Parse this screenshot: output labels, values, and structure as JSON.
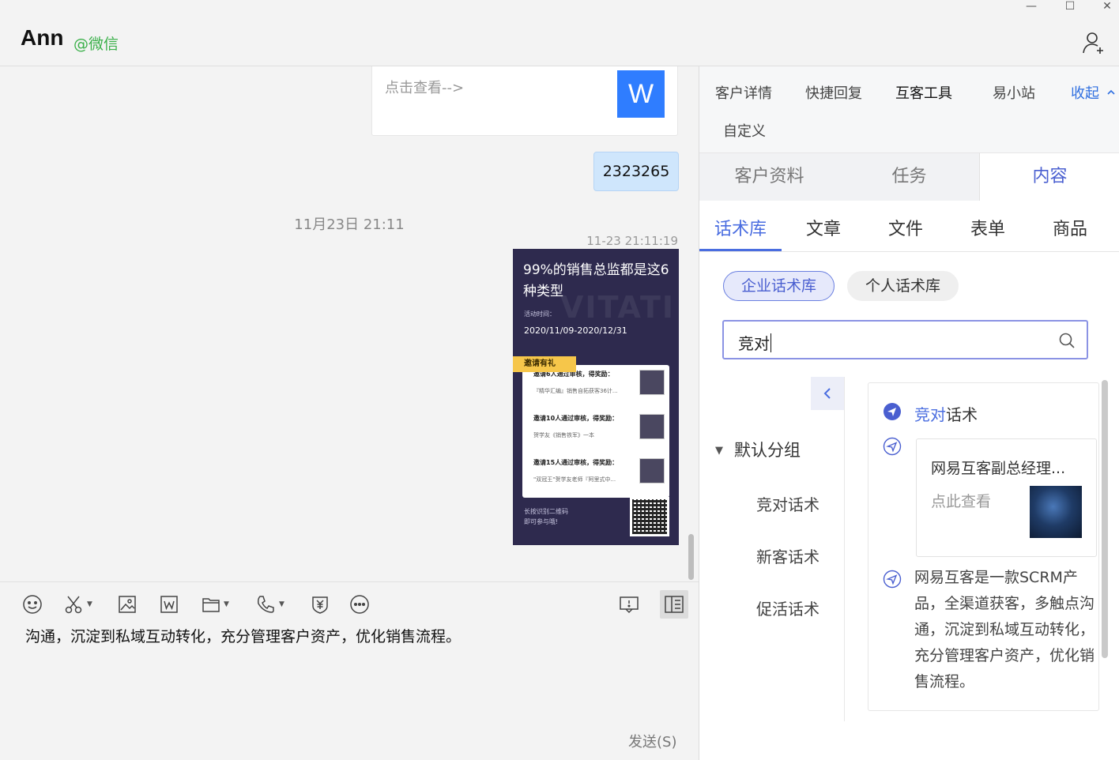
{
  "window": {
    "controls": {
      "minimize": "—",
      "maximize": "☐",
      "close": "✕"
    }
  },
  "header": {
    "contact_name": "Ann",
    "contact_source": "@微信"
  },
  "chat": {
    "card": {
      "text": "点击查看-->",
      "icon_letter": "W"
    },
    "bubble": "2323265",
    "date_divider": "11月23日 21:11",
    "message_time": "11-23 21:11:19",
    "poster": {
      "title": "99%的销售总监都是这6种类型",
      "watermark": "VITATI",
      "time_label": "活动时间：",
      "date_range": "2020/11/09-2020/12/31",
      "tag": "邀请有礼",
      "rows": [
        {
          "title": "邀请6人通过审核，得奖励：",
          "sub": "『精华汇编』销售自拓获客36计..."
        },
        {
          "title": "邀请10人通过审核，得奖励：",
          "sub": "贺学友《销售铁军》一本"
        },
        {
          "title": "邀请15人通过审核，得奖励：",
          "sub": "\"双冠王\"贺学友老师『阿里式中..."
        }
      ],
      "footer_1": "长按识别二维码",
      "footer_2": "即可参与哦!"
    }
  },
  "composer": {
    "draft_text": "沟通，沉淀到私域互动转化，充分管理客户资产，优化销售流程。",
    "send_label": "发送(S)"
  },
  "panel": {
    "top_tabs": [
      "客户详情",
      "快捷回复",
      "互客工具",
      "易小站",
      "收起"
    ],
    "custom_tab": "自定义",
    "segments": [
      "客户资料",
      "任务",
      "内容"
    ],
    "sub_tabs": [
      "话术库",
      "文章",
      "文件",
      "表单",
      "商品"
    ],
    "pills": [
      "企业话术库",
      "个人话术库"
    ],
    "search_value": "竞对",
    "group_header": "默认分组",
    "group_items": [
      "竞对话术",
      "新客话术",
      "促活话术"
    ],
    "result_title_highlight": "竞对",
    "result_title_rest": "话术",
    "result_card": {
      "title": "网易互客副总经理...",
      "link": "点此查看"
    },
    "result_text": "网易互客是一款SCRM产品，全渠道获客，多触点沟通，沉淀到私域互动转化，充分管理客户资产，优化销售流程。"
  }
}
